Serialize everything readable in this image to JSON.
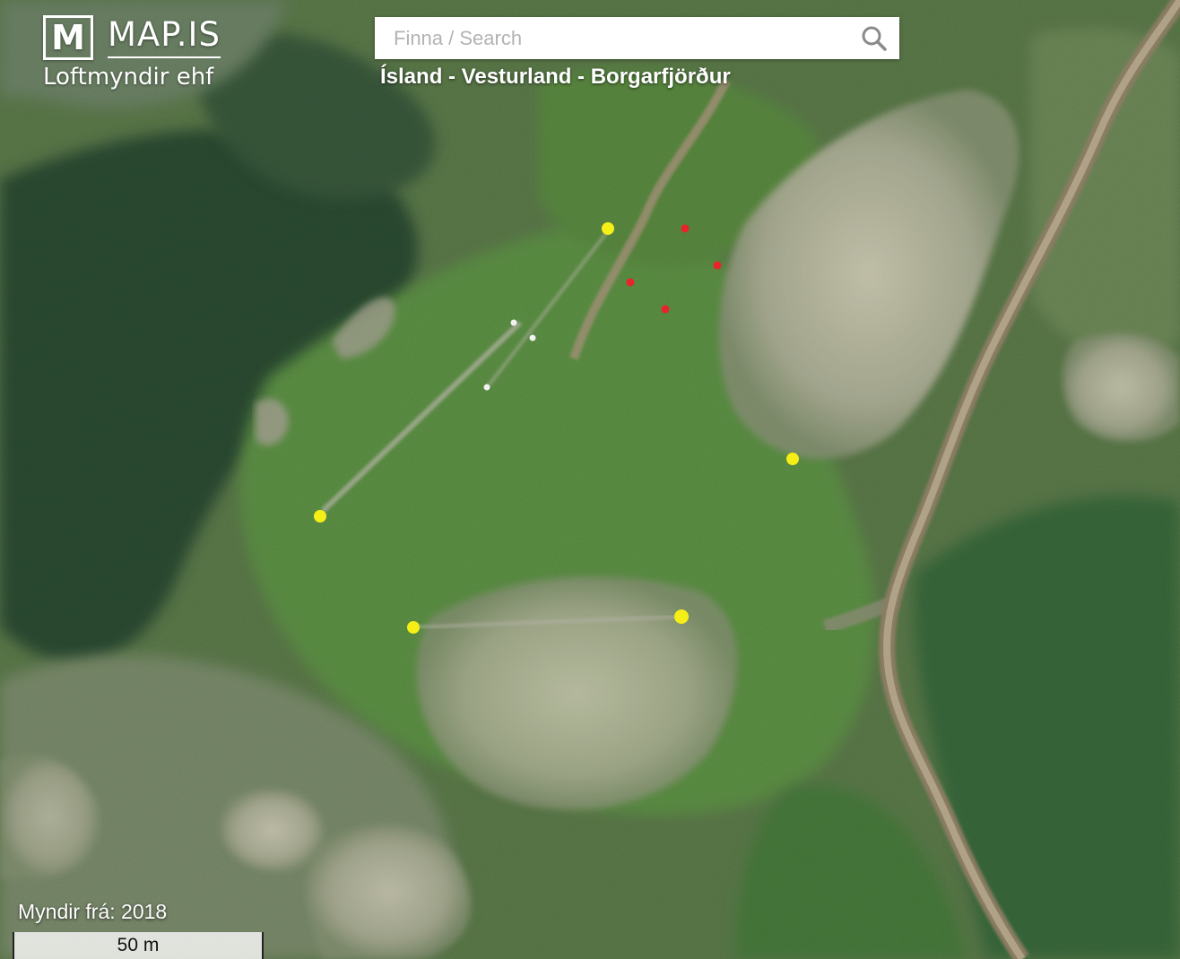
{
  "branding": {
    "logo_letter": "M",
    "logo_name": "MAP.IS",
    "logo_subtitle": "Loftmyndir ehf"
  },
  "search": {
    "placeholder": "Finna / Search",
    "value": "",
    "icon": "search-icon"
  },
  "breadcrumb": "Ísland - Vesturland - Borgarfjörður",
  "photo_year_label": "Myndir frá: 2018",
  "scale_label": "50 m",
  "map": {
    "type": "aerial-photo",
    "markers": [
      {
        "color": "#f5ef17",
        "kind": "yellow"
      },
      {
        "color": "#f5ef17",
        "kind": "yellow"
      },
      {
        "color": "#f5ef17",
        "kind": "yellow"
      },
      {
        "color": "#f5ef17",
        "kind": "yellow"
      },
      {
        "color": "#f5ef17",
        "kind": "yellow"
      },
      {
        "color": "#e8242b",
        "kind": "red"
      },
      {
        "color": "#e8242b",
        "kind": "red"
      },
      {
        "color": "#e8242b",
        "kind": "red"
      },
      {
        "color": "#e8242b",
        "kind": "red"
      },
      {
        "color": "#f2f2f2",
        "kind": "white"
      },
      {
        "color": "#f2f2f2",
        "kind": "white"
      },
      {
        "color": "#f2f2f2",
        "kind": "white"
      }
    ]
  }
}
